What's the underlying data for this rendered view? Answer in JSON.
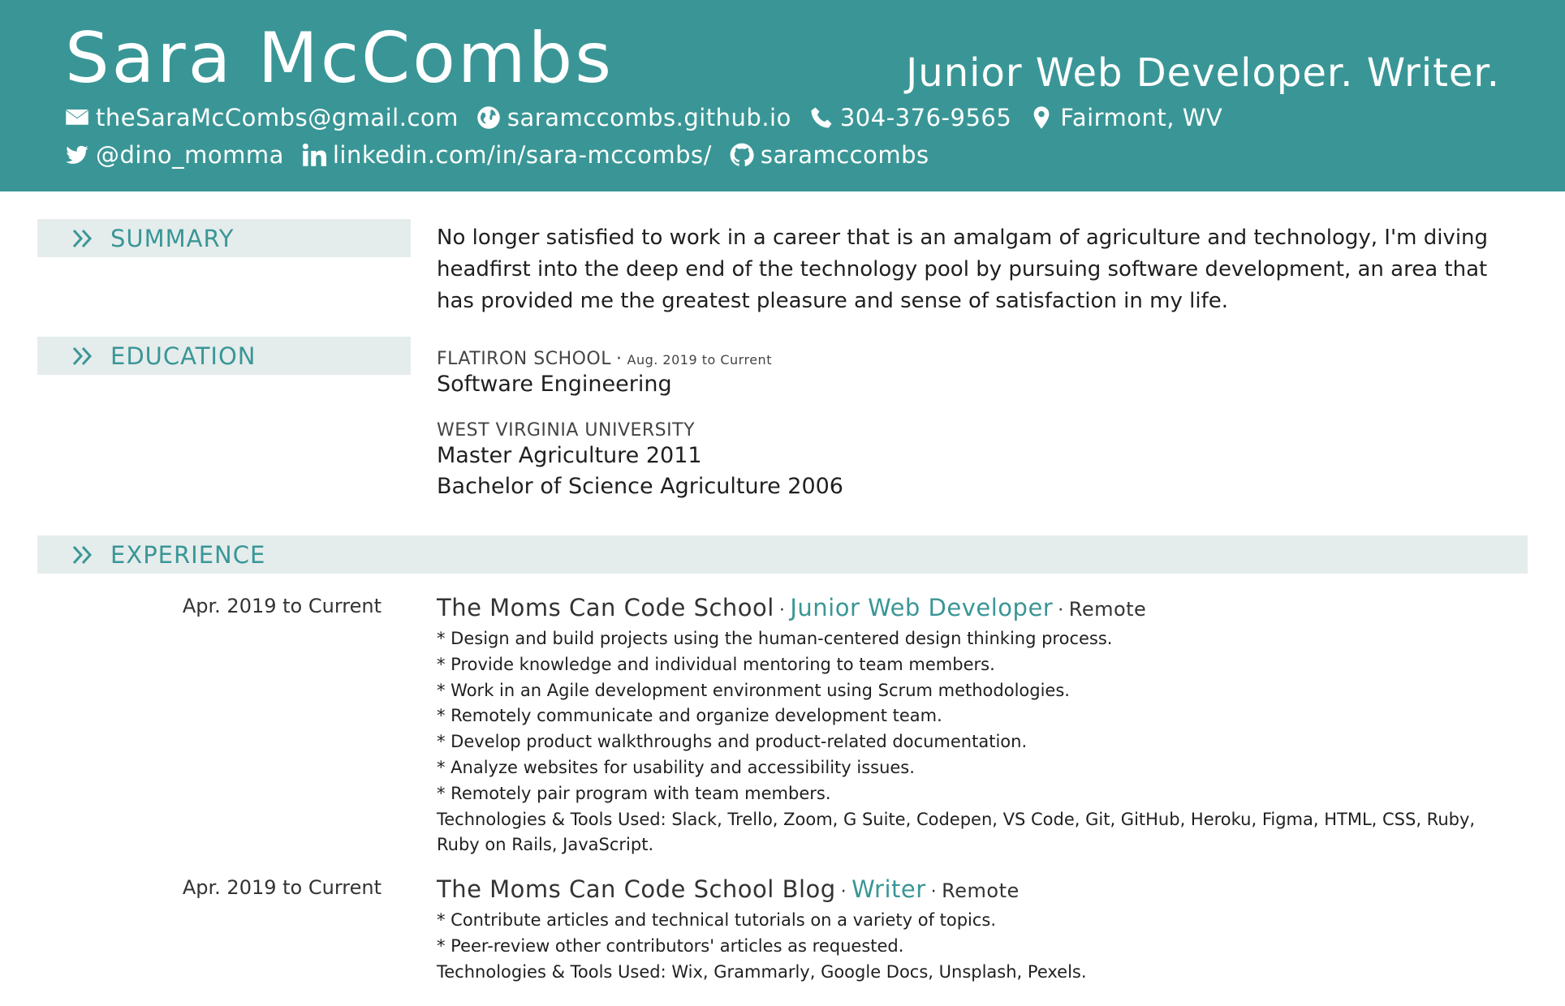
{
  "header": {
    "name": "Sara McCombs",
    "tagline": "Junior Web Developer. Writer.",
    "contacts_row1": [
      {
        "icon": "envelope-icon",
        "text": "theSaraMcCombs@gmail.com"
      },
      {
        "icon": "globe-icon",
        "text": "saramccombs.github.io"
      },
      {
        "icon": "phone-icon",
        "text": "304-376-9565"
      },
      {
        "icon": "map-marker-icon",
        "text": "Fairmont, WV"
      }
    ],
    "contacts_row2": [
      {
        "icon": "twitter-icon",
        "text": "@dino_momma"
      },
      {
        "icon": "linkedin-icon",
        "text": "linkedin.com/in/sara-mccombs/"
      },
      {
        "icon": "github-icon",
        "text": "saramccombs"
      }
    ]
  },
  "sections": {
    "summary_title": "SUMMARY",
    "education_title": "EDUCATION",
    "experience_title": "EXPERIENCE"
  },
  "summary": {
    "text": "No longer satisfied to work in a career that is an amalgam of agriculture and technology, I'm diving headfirst into the deep end of the technology pool by pursuing software development, an area that has provided me the greatest pleasure and sense of satisfaction in my life."
  },
  "education": [
    {
      "school": "FLATIRON SCHOOL",
      "separator": "·",
      "date": "Aug. 2019 to Current",
      "degrees": [
        "Software Engineering"
      ]
    },
    {
      "school": "WEST VIRGINIA UNIVERSITY",
      "date": "",
      "degrees": [
        "Master Agriculture 2011",
        "Bachelor of Science Agriculture 2006"
      ]
    }
  ],
  "experience": [
    {
      "date": "Apr. 2019 to Current",
      "org": "The Moms Can Code School",
      "role": "Junior Web Developer",
      "location": "Remote",
      "bullets": [
        "* Design and build projects using the human-centered design thinking process.",
        "* Provide knowledge and individual mentoring to team members.",
        "* Work in an Agile development environment using Scrum methodologies.",
        "* Remotely communicate and organize development team.",
        "* Develop product walkthroughs and product-related documentation.",
        "* Analyze websites for usability and accessibility issues.",
        "* Remotely pair program with team members."
      ],
      "tools": "Technologies & Tools Used: Slack, Trello, Zoom, G Suite, Codepen, VS Code, Git, GitHub, Heroku, Figma, HTML, CSS, Ruby, Ruby on Rails, JavaScript."
    },
    {
      "date": "Apr. 2019 to Current",
      "org": "The Moms Can Code School Blog",
      "role": "Writer",
      "location": "Remote",
      "bullets": [
        "* Contribute articles and technical tutorials on a variety of topics.",
        "* Peer-review other contributors' articles as requested."
      ],
      "tools": "Technologies & Tools Used: Wix, Grammarly, Google Docs, Unsplash, Pexels."
    }
  ],
  "colors": {
    "accent": "#3a9696",
    "section_bg": "#e5ecec"
  }
}
